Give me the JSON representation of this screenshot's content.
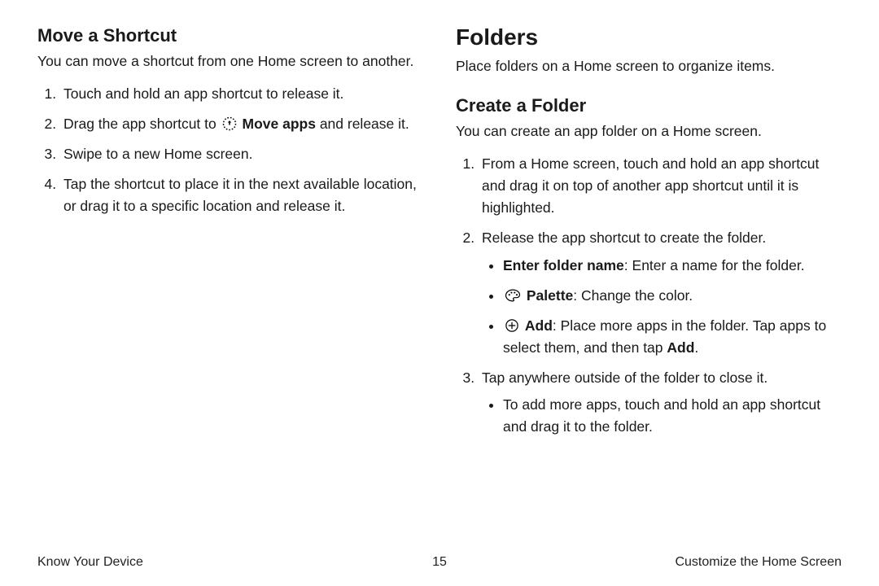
{
  "left": {
    "heading": "Move a Shortcut",
    "intro": "You can move a shortcut from one Home screen to another.",
    "steps": {
      "s1": "Touch and hold an app shortcut to release it.",
      "s2a": "Drag the app shortcut to ",
      "s2b_bold": "Move apps",
      "s2c": " and release it.",
      "s3": "Swipe to a new Home screen.",
      "s4": "Tap the shortcut to place it in the next available location, or drag it to a specific location and release it."
    }
  },
  "right": {
    "h1": "Folders",
    "intro1": "Place folders on a Home screen to organize items.",
    "h2": "Create a Folder",
    "intro2": "You can create an app folder on a Home screen.",
    "steps": {
      "s1": "From a Home screen, touch and hold an app shortcut and drag it on top of another app shortcut until it is highlighted.",
      "s2": "Release the app shortcut to create the folder.",
      "sub": {
        "a_bold": "Enter folder name",
        "a_rest": ": Enter a name for the folder.",
        "b_bold": "Palette",
        "b_rest": ": Change the color.",
        "c_bold": "Add",
        "c_mid": ": Place more apps in the folder. Tap apps to select them, and then tap ",
        "c_bold2": "Add",
        "c_end": "."
      },
      "s3": "Tap anywhere outside of the folder to close it.",
      "sub3": "To add more apps, touch and hold an app shortcut and drag it to the folder."
    }
  },
  "footer": {
    "left": "Know Your Device",
    "page": "15",
    "right": "Customize the Home Screen"
  }
}
